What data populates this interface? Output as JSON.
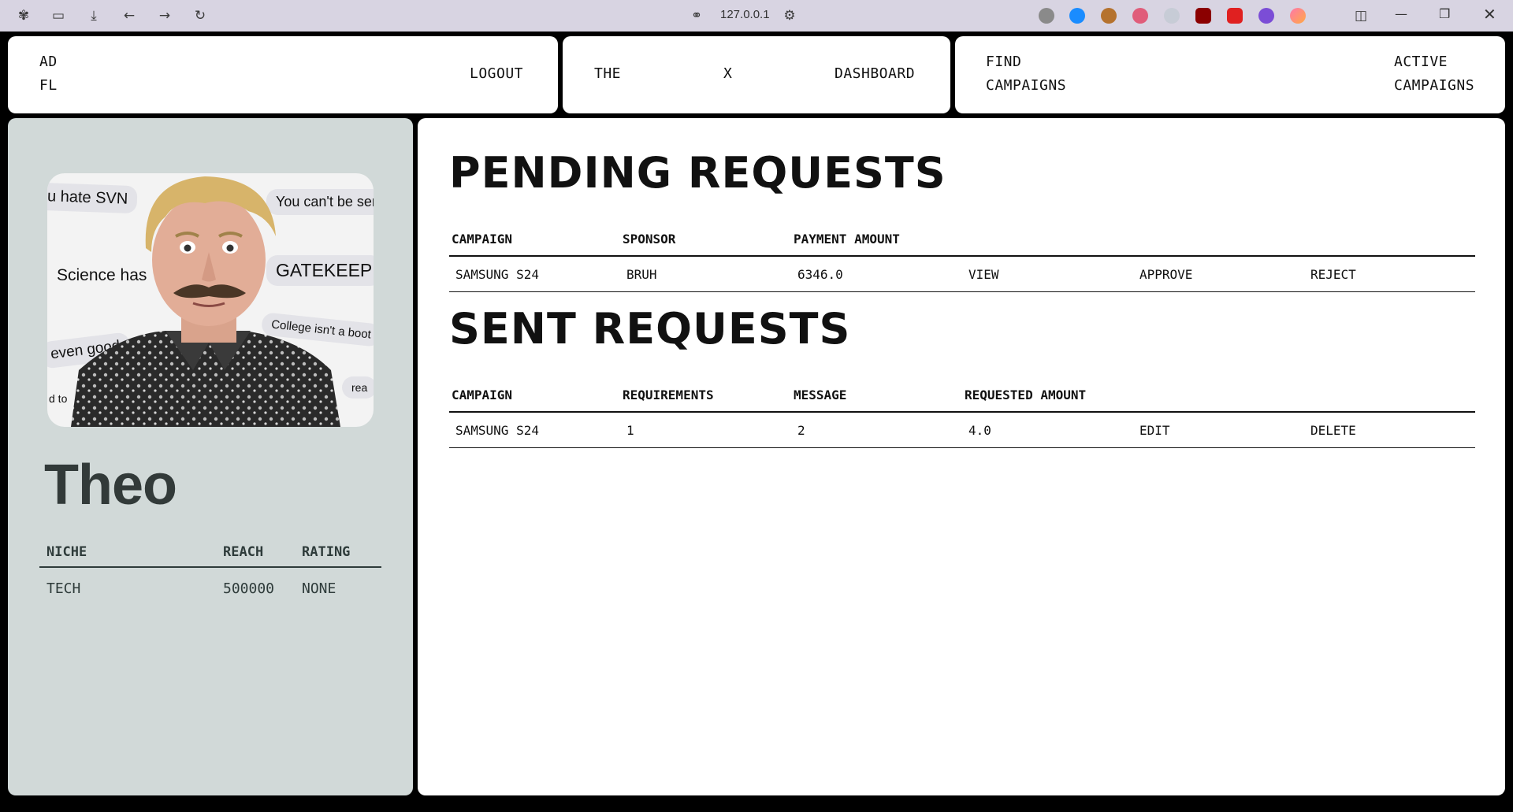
{
  "browser": {
    "url": "127.0.0.1"
  },
  "nav": {
    "brand_line1": "AD",
    "brand_line2": "FL",
    "logout": "LOGOUT",
    "the": "THE",
    "x": "X",
    "dashboard": "DASHBOARD",
    "find_line1": "FIND",
    "find_line2": "CAMPAIGNS",
    "active_line1": "ACTIVE",
    "active_line2": "CAMPAIGNS"
  },
  "profile": {
    "name": "Theo",
    "image_bubbles": [
      "u hate SVN",
      "You can't be ser",
      "Science has",
      "GATEKEEP",
      "College isn't a boot",
      "even good",
      "d to",
      "rea"
    ],
    "stats_headers": {
      "niche": "NICHE",
      "reach": "REACH",
      "rating": "RATING"
    },
    "stats_row": {
      "niche": "TECH",
      "reach": "500000",
      "rating": "NONE"
    }
  },
  "pending": {
    "title": "PENDING REQUESTS",
    "headers": [
      "CAMPAIGN",
      "SPONSOR",
      "PAYMENT AMOUNT"
    ],
    "rows": [
      {
        "campaign": "SAMSUNG S24",
        "sponsor": "BRUH",
        "amount": "6346.0",
        "view": "VIEW",
        "approve": "APPROVE",
        "reject": "REJECT"
      }
    ]
  },
  "sent": {
    "title": "SENT REQUESTS",
    "headers": [
      "CAMPAIGN",
      "REQUIREMENTS",
      "MESSAGE",
      "REQUESTED AMOUNT"
    ],
    "rows": [
      {
        "campaign": "SAMSUNG S24",
        "requirements": "1",
        "message": "2",
        "amount": "4.0",
        "edit": "EDIT",
        "delete": "DELETE"
      }
    ]
  },
  "colors": {
    "sidebar_bg": "#d1d9d8",
    "frame_bg": "#000000",
    "chrome_bg": "#d8d4e2",
    "text_dark": "#111111"
  }
}
